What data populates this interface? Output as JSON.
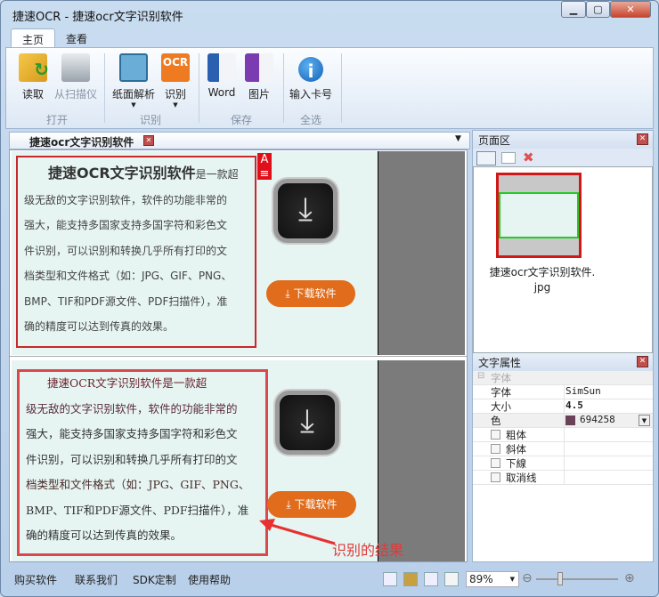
{
  "window": {
    "title": "捷速OCR - 捷速ocr文字识别软件",
    "controls": [
      "minimize",
      "maximize",
      "close"
    ]
  },
  "ribbon": {
    "tabs": [
      {
        "label": "主页",
        "active": true
      },
      {
        "label": "查看",
        "active": false
      }
    ],
    "groups": [
      {
        "label": "打开",
        "buttons": [
          {
            "label": "读取",
            "icon": "folder-open-icon"
          },
          {
            "label": "从扫描仪",
            "icon": "scanner-icon",
            "disabled": true
          }
        ]
      },
      {
        "label": "识别",
        "buttons": [
          {
            "label": "纸面解析",
            "icon": "layout-analysis-icon",
            "dropdown": true
          },
          {
            "label": "识别",
            "icon": "ocr-icon",
            "dropdown": true
          }
        ]
      },
      {
        "label": "保存",
        "buttons": [
          {
            "label": "Word",
            "icon": "word-doc-icon"
          },
          {
            "label": "图片",
            "icon": "image-doc-icon"
          }
        ]
      },
      {
        "label": "全选",
        "buttons": [
          {
            "label": "输入卡号",
            "icon": "info-icon"
          }
        ]
      }
    ],
    "ocr_icon_text": "OCR"
  },
  "document": {
    "tab_label": "捷速ocr文字识别软件",
    "source_heading": "捷速OCR文字识别软件",
    "source_text": "是一款超级无敌的文字识别软件，软件的功能非常的强大，能支持多国家支持多国字符和彩色文件识别，可以识别和转换几乎所有打印的文档类型和文件格式（如：JPG、GIF、PNG、BMP、TIF和PDF源文件、PDF扫描件），准确的精度可以达到传真的效果。",
    "source_lines": [
      "级无敌的文字识别软件，软件的功能非常的",
      "强大，能支持多国家支持多国字符和彩色文",
      "件识别，可以识别和转换几乎所有打印的文",
      "档类型和文件格式（如：JPG、GIF、PNG、",
      "BMP、TIF和PDF源文件、PDF扫描件），准",
      "确的精度可以达到传真的效果。"
    ],
    "source_first_tail": "是一款超",
    "zone_marker": "A",
    "ocr_lines": [
      "捷速OCR文字识别软件是一款超",
      "级无敌的文字识别软件，软件的功能非常的",
      "强大，能支持多国家支持多国字符和彩色文",
      "件识别，可以识别和转换几乎所有打印的文",
      "档类型和文件格式（如：JPG、GIF、PNG、",
      "BMP、TIF和PDF源文件、PDF扫描件），准",
      "确的精度可以达到传真的效果。"
    ],
    "download_label": "下载软件",
    "annotation": "识别的结果",
    "accent": "#e06c1c",
    "zone_color": "#d02020"
  },
  "pages_panel": {
    "title": "页面区",
    "thumb_label": "捷速ocr文字识别软件.jpg",
    "thumb_line1": "捷速ocr文字识别软件.",
    "thumb_line2": "jpg"
  },
  "text_props": {
    "title": "文字属性",
    "category": "字体",
    "rows": [
      {
        "key": "字体",
        "value": "SimSun"
      },
      {
        "key": "大小",
        "value": "4.5"
      },
      {
        "key": "色",
        "value": "694258",
        "swatch": "#694258"
      }
    ],
    "checks": [
      {
        "label": "粗体",
        "checked": false
      },
      {
        "label": "斜体",
        "checked": false
      },
      {
        "label": "下線",
        "checked": false
      },
      {
        "label": "取消线",
        "checked": false
      }
    ]
  },
  "status": {
    "links": [
      "购买软件",
      "联系我们",
      "SDK定制",
      "使用帮助"
    ],
    "zoom": "89%"
  }
}
